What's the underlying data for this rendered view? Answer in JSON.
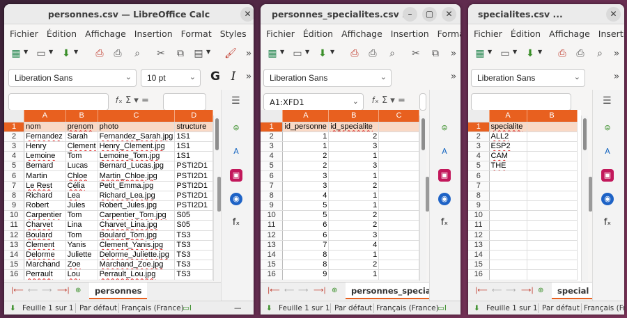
{
  "windows": [
    {
      "title": "personnes.csv — LibreOffice Calc",
      "menu": [
        "Fichier",
        "Édition",
        "Affichage",
        "Insertion",
        "Format",
        "Styles",
        "Fe"
      ],
      "font_name": "Liberation Sans",
      "font_size": "10 pt",
      "name_box": "",
      "columns": [
        "A",
        "B",
        "C",
        "D"
      ],
      "rows": [
        [
          "1",
          "nom",
          "prenom",
          "photo",
          "structure"
        ],
        [
          "2",
          "Fernandez",
          "Sarah",
          "Fernandez_Sarah.jpg",
          "1S1"
        ],
        [
          "3",
          "Henry",
          "Clement",
          "Henry_Clement.jpg",
          "1S1"
        ],
        [
          "4",
          "Lemoine",
          "Tom",
          "Lemoine_Tom.jpg",
          "1S1"
        ],
        [
          "5",
          "Bernard",
          "Lucas",
          "Bernard_Lucas.jpg",
          "PSTI2D1"
        ],
        [
          "6",
          "Martin",
          "Chloe",
          "Martin_Chloe.jpg",
          "PSTI2D1"
        ],
        [
          "7",
          "Le Rest",
          "Célia",
          "Petit_Emma.jpg",
          "PSTI2D1"
        ],
        [
          "8",
          "Richard",
          "Lea",
          "Richard_Lea.jpg",
          "PSTI2D1"
        ],
        [
          "9",
          "Robert",
          "Jules",
          "Robert_Jules.jpg",
          "PSTI2D1"
        ],
        [
          "10",
          "Carpentier",
          "Tom",
          "Carpentier_Tom.jpg",
          "S05"
        ],
        [
          "11",
          "Charvet",
          "Lina",
          "Charvet_Lina.jpg",
          "S05"
        ],
        [
          "12",
          "Boulard",
          "Tom",
          "Boulard_Tom.jpg",
          "TS3"
        ],
        [
          "13",
          "Clement",
          "Yanis",
          "Clement_Yanis.jpg",
          "TS3"
        ],
        [
          "14",
          "Delorme",
          "Juliette",
          "Delorme_Juliette.jpg",
          "TS3"
        ],
        [
          "15",
          "Marchand",
          "Zoe",
          "Marchand_Zoe.jpg",
          "TS3"
        ],
        [
          "16",
          "Perrault",
          "Lou",
          "Perrault_Lou.jpg",
          "TS3"
        ]
      ],
      "sheet_tab": "personnes",
      "status": [
        "Feuille 1 sur 1",
        "Par défaut",
        "Français (France)"
      ]
    },
    {
      "title": "personnes_specialites.csv ...",
      "menu": [
        "Fichier",
        "Édition",
        "Affichage",
        "Insertion",
        "Format"
      ],
      "font_name": "Liberation Sans",
      "name_box": "A1:XFD1",
      "columns": [
        "A",
        "B",
        "C"
      ],
      "rows": [
        [
          "1",
          "id_personne",
          "id_specialite",
          ""
        ],
        [
          "2",
          "1",
          "2",
          ""
        ],
        [
          "3",
          "1",
          "3",
          ""
        ],
        [
          "4",
          "2",
          "1",
          ""
        ],
        [
          "5",
          "2",
          "3",
          ""
        ],
        [
          "6",
          "3",
          "1",
          ""
        ],
        [
          "7",
          "3",
          "2",
          ""
        ],
        [
          "8",
          "4",
          "1",
          ""
        ],
        [
          "9",
          "5",
          "1",
          ""
        ],
        [
          "10",
          "5",
          "2",
          ""
        ],
        [
          "11",
          "6",
          "2",
          ""
        ],
        [
          "12",
          "6",
          "3",
          ""
        ],
        [
          "13",
          "7",
          "4",
          ""
        ],
        [
          "14",
          "8",
          "1",
          ""
        ],
        [
          "15",
          "8",
          "2",
          ""
        ],
        [
          "16",
          "9",
          "1",
          ""
        ]
      ],
      "sheet_tab": "personnes_specialites",
      "status": [
        "Feuille 1 sur 1",
        "Par défaut",
        "Français (France)"
      ]
    },
    {
      "title": "specialites.csv ...",
      "menu": [
        "Fichier",
        "Édition",
        "Affichage",
        "Insertion"
      ],
      "font_name": "Liberation Sans",
      "name_box": "",
      "columns": [
        "A",
        "B"
      ],
      "rows": [
        [
          "1",
          "specialite",
          ""
        ],
        [
          "2",
          "ALL2",
          ""
        ],
        [
          "3",
          "ESP2",
          ""
        ],
        [
          "4",
          "CAM",
          ""
        ],
        [
          "5",
          "THE",
          ""
        ],
        [
          "6",
          "",
          ""
        ],
        [
          "7",
          "",
          ""
        ],
        [
          "8",
          "",
          ""
        ],
        [
          "9",
          "",
          ""
        ],
        [
          "10",
          "",
          ""
        ],
        [
          "11",
          "",
          ""
        ],
        [
          "12",
          "",
          ""
        ],
        [
          "13",
          "",
          ""
        ],
        [
          "14",
          "",
          ""
        ],
        [
          "15",
          "",
          ""
        ],
        [
          "16",
          "",
          ""
        ]
      ],
      "sheet_tab": "special",
      "status": [
        "Feuille 1 sur 1",
        "Par défaut",
        "Français (France)"
      ]
    }
  ],
  "colors": {
    "accent": "#e8601f",
    "highlight": "#f9d9c6"
  },
  "icons": [
    "new-icon",
    "open-icon",
    "save-icon",
    "pdf-icon",
    "print-icon",
    "print-preview-icon",
    "cut-icon",
    "copy-icon",
    "paste-icon",
    "clone-icon",
    "more-icon",
    "properties-icon",
    "styles-icon",
    "gallery-icon",
    "navigator-icon",
    "functions-icon",
    "menu-icon"
  ]
}
